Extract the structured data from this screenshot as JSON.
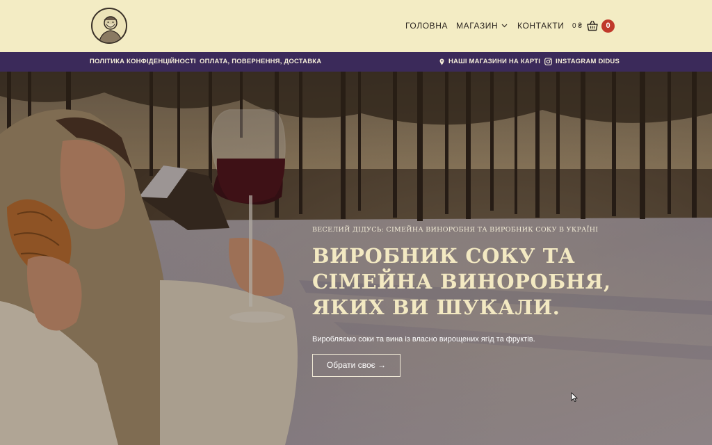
{
  "header": {
    "logo_icon": "grandpa-logo-icon",
    "nav": {
      "home": "ГОЛОВНА",
      "shop": "МАГАЗИН",
      "contacts": "КОНТАКТИ"
    },
    "cart": {
      "price": "0 ₴",
      "count": "0",
      "icon": "basket-icon"
    }
  },
  "topbar": {
    "privacy": "ПОЛІТИКА КОНФІДЕНЦІЙНОСТІ",
    "payment": "ОПЛАТА, ПОВЕРНЕННЯ, ДОСТАВКА",
    "map": "НАШІ МАГАЗИНИ НА КАРТІ",
    "instagram": "INSTAGRAM DIDUS"
  },
  "hero": {
    "overline": "ВЕСЕЛИЙ ДІДУСЬ: СІМЕЙНА ВИНОРОБНЯ ТА ВИРОБНИК СОКУ В УКРАЇНІ",
    "title_line1": "ВИРОБНИК СОКУ ТА",
    "title_line2": "СІМЕЙНА ВИНОРОБНЯ,",
    "title_line3": "ЯКИХ ВИ ШУКАЛИ.",
    "subtitle": "Виробляємо соки та вина із власно вирощених ягід та фруктів.",
    "button": "Обрати своє →"
  },
  "colors": {
    "header_bg": "#f3ecc4",
    "topbar_bg": "#3b2a5a",
    "badge": "#c0392b",
    "hero_title": "#f3e9c2"
  }
}
